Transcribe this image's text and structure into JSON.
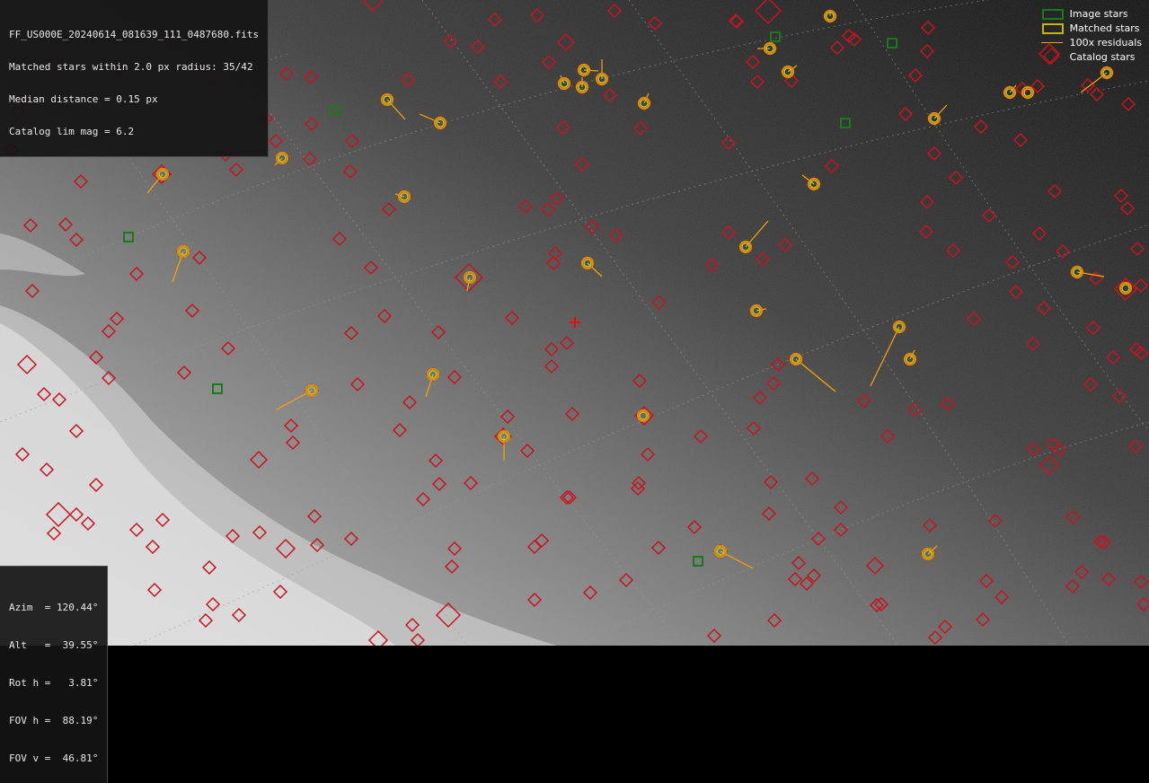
{
  "header": {
    "filename": "FF_US000E_20240614_081639_111_0487680.fits",
    "matched_line": "Matched stars within 2.0 px radius: 35/42",
    "median_line": "Median distance = 0.15 px",
    "catalog_line": "Catalog lim mag = 6.2"
  },
  "pointing": {
    "azim": "Azim  = 120.44°",
    "alt": "Alt   =  39.55°",
    "rot": "Rot h =   3.81°",
    "fov_h": "FOV h =  88.19°",
    "fov_v": "FOV v =  46.81°"
  },
  "legend": {
    "image_stars": "Image stars",
    "matched_stars": "Matched stars",
    "residuals": "100x residuals",
    "catalog_stars": "Catalog stars"
  },
  "colors": {
    "catalog": "#c8141e",
    "image": "#1a7a1a",
    "matched_outer": "#e08a00",
    "matched_inner": "#b4d22a",
    "residual": "#ffa500",
    "center_cross": "#ff0000"
  },
  "stars": {
    "image_unmatched": [
      [
        373,
        123
      ],
      [
        941,
        137
      ],
      [
        143,
        264
      ],
      [
        242,
        433
      ],
      [
        777,
        625
      ],
      [
        863,
        41
      ],
      [
        993,
        48
      ]
    ],
    "matched": [
      [
        431,
        111,
        451,
        133
      ],
      [
        490,
        137,
        467,
        127
      ],
      [
        314,
        176,
        306,
        184
      ],
      [
        181,
        194,
        164,
        215
      ],
      [
        204,
        280,
        192,
        314
      ],
      [
        450,
        219,
        440,
        216
      ],
      [
        523,
        309,
        520,
        324
      ],
      [
        654,
        293,
        670,
        308
      ],
      [
        628,
        93,
        624,
        84
      ],
      [
        648,
        97,
        648,
        86
      ],
      [
        650,
        78,
        666,
        79
      ],
      [
        670,
        88,
        670,
        66
      ],
      [
        717,
        115,
        722,
        104
      ],
      [
        857,
        54,
        843,
        54
      ],
      [
        877,
        80,
        887,
        73
      ],
      [
        924,
        18,
        924,
        13
      ],
      [
        906,
        205,
        893,
        195
      ],
      [
        830,
        275,
        855,
        246
      ],
      [
        842,
        346,
        853,
        344
      ],
      [
        1040,
        132,
        1054,
        117
      ],
      [
        1124,
        103,
        1131,
        95
      ],
      [
        1144,
        103,
        1144,
        103
      ],
      [
        1232,
        81,
        1203,
        103
      ],
      [
        1199,
        303,
        1229,
        308
      ],
      [
        1253,
        321,
        1253,
        321
      ],
      [
        1001,
        364,
        969,
        430
      ],
      [
        1013,
        400,
        1018,
        390
      ],
      [
        886,
        400,
        930,
        436
      ],
      [
        716,
        463,
        716,
        463
      ],
      [
        347,
        435,
        308,
        456
      ],
      [
        482,
        417,
        474,
        442
      ],
      [
        561,
        486,
        561,
        513
      ],
      [
        802,
        614,
        838,
        633
      ],
      [
        1033,
        617,
        1043,
        608
      ]
    ],
    "catalog_big": [
      [
        415,
        2,
        10
      ],
      [
        855,
        12,
        14
      ],
      [
        630,
        47,
        9
      ],
      [
        1168,
        60,
        11
      ],
      [
        522,
        309,
        15
      ],
      [
        30,
        406,
        10
      ],
      [
        65,
        573,
        13
      ],
      [
        499,
        685,
        13
      ],
      [
        1168,
        518,
        10
      ],
      [
        1253,
        322,
        12
      ],
      [
        421,
        713,
        10
      ],
      [
        318,
        611,
        10
      ],
      [
        288,
        512,
        9
      ],
      [
        974,
        630,
        9
      ],
      [
        717,
        463,
        10
      ],
      [
        180,
        194,
        10
      ],
      [
        560,
        486,
        9
      ]
    ],
    "catalog_small": [
      [
        551,
        22
      ],
      [
        598,
        17
      ],
      [
        684,
        12
      ],
      [
        729,
        26
      ],
      [
        820,
        24
      ],
      [
        838,
        69
      ],
      [
        843,
        91
      ],
      [
        932,
        53
      ],
      [
        945,
        40
      ],
      [
        1019,
        84
      ],
      [
        1032,
        57
      ],
      [
        1033,
        31
      ],
      [
        1040,
        171
      ],
      [
        1008,
        127
      ],
      [
        1064,
        198
      ],
      [
        1092,
        141
      ],
      [
        1101,
        240
      ],
      [
        1136,
        156
      ],
      [
        1174,
        213
      ],
      [
        1157,
        260
      ],
      [
        1183,
        280
      ],
      [
        1127,
        292
      ],
      [
        1131,
        325
      ],
      [
        1162,
        343
      ],
      [
        1217,
        365
      ],
      [
        1150,
        383
      ],
      [
        1239,
        398
      ],
      [
        1214,
        428
      ],
      [
        1246,
        441
      ],
      [
        1264,
        497
      ],
      [
        1225,
        603
      ],
      [
        1204,
        637
      ],
      [
        1234,
        645
      ],
      [
        1270,
        648
      ],
      [
        1273,
        673
      ],
      [
        1194,
        653
      ],
      [
        1115,
        665
      ],
      [
        1094,
        690
      ],
      [
        1052,
        698
      ],
      [
        1041,
        710
      ],
      [
        1098,
        647
      ],
      [
        1108,
        580
      ],
      [
        1194,
        576
      ],
      [
        1035,
        585
      ],
      [
        988,
        486
      ],
      [
        1055,
        450
      ],
      [
        1018,
        456
      ],
      [
        962,
        446
      ],
      [
        936,
        565
      ],
      [
        936,
        590
      ],
      [
        911,
        600
      ],
      [
        889,
        627
      ],
      [
        885,
        645
      ],
      [
        906,
        641
      ],
      [
        898,
        650
      ],
      [
        858,
        537
      ],
      [
        904,
        533
      ],
      [
        856,
        572
      ],
      [
        839,
        477
      ],
      [
        846,
        443
      ],
      [
        866,
        406
      ],
      [
        861,
        427
      ],
      [
        780,
        486
      ],
      [
        773,
        587
      ],
      [
        733,
        610
      ],
      [
        697,
        646
      ],
      [
        657,
        660
      ],
      [
        595,
        668
      ],
      [
        634,
        554
      ],
      [
        603,
        602
      ],
      [
        595,
        609
      ],
      [
        506,
        611
      ],
      [
        503,
        631
      ],
      [
        524,
        538
      ],
      [
        489,
        539
      ],
      [
        485,
        513
      ],
      [
        471,
        556
      ],
      [
        445,
        479
      ],
      [
        456,
        448
      ],
      [
        398,
        428
      ],
      [
        391,
        600
      ],
      [
        353,
        607
      ],
      [
        350,
        575
      ],
      [
        326,
        493
      ],
      [
        324,
        474
      ],
      [
        312,
        659
      ],
      [
        266,
        685
      ],
      [
        237,
        673
      ],
      [
        229,
        691
      ],
      [
        233,
        632
      ],
      [
        259,
        597
      ],
      [
        289,
        593
      ],
      [
        172,
        657
      ],
      [
        170,
        609
      ],
      [
        152,
        590
      ],
      [
        181,
        579
      ],
      [
        98,
        583
      ],
      [
        107,
        540
      ],
      [
        85,
        480
      ],
      [
        52,
        523
      ],
      [
        25,
        506
      ],
      [
        66,
        445
      ],
      [
        49,
        439
      ],
      [
        121,
        421
      ],
      [
        107,
        398
      ],
      [
        205,
        415
      ],
      [
        254,
        388
      ],
      [
        130,
        355
      ],
      [
        121,
        369
      ],
      [
        36,
        324
      ],
      [
        152,
        305
      ],
      [
        214,
        346
      ],
      [
        222,
        287
      ],
      [
        85,
        267
      ],
      [
        73,
        250
      ],
      [
        34,
        251
      ],
      [
        90,
        202
      ],
      [
        13,
        167
      ],
      [
        20,
        125
      ],
      [
        25,
        112
      ],
      [
        58,
        74
      ],
      [
        131,
        78
      ],
      [
        192,
        48
      ],
      [
        242,
        91
      ],
      [
        225,
        79
      ],
      [
        319,
        82
      ],
      [
        346,
        86
      ],
      [
        296,
        132
      ],
      [
        347,
        138
      ],
      [
        345,
        177
      ],
      [
        263,
        189
      ],
      [
        251,
        172
      ],
      [
        307,
        157
      ],
      [
        392,
        157
      ],
      [
        390,
        191
      ],
      [
        378,
        266
      ],
      [
        413,
        298
      ],
      [
        433,
        233
      ],
      [
        391,
        371
      ],
      [
        428,
        352
      ],
      [
        488,
        370
      ],
      [
        506,
        420
      ],
      [
        570,
        354
      ],
      [
        614,
        389
      ],
      [
        614,
        408
      ],
      [
        631,
        382
      ],
      [
        637,
        461
      ],
      [
        565,
        464
      ],
      [
        587,
        502
      ],
      [
        631,
        554
      ],
      [
        618,
        282
      ],
      [
        616,
        293
      ],
      [
        610,
        233
      ],
      [
        620,
        221
      ],
      [
        585,
        230
      ],
      [
        659,
        253
      ],
      [
        686,
        262
      ],
      [
        734,
        337
      ],
      [
        793,
        295
      ],
      [
        811,
        259
      ],
      [
        849,
        289
      ],
      [
        874,
        273
      ],
      [
        811,
        159
      ],
      [
        713,
        143
      ],
      [
        627,
        142
      ],
      [
        648,
        183
      ],
      [
        679,
        106
      ],
      [
        557,
        91
      ],
      [
        501,
        46
      ],
      [
        532,
        52
      ],
      [
        454,
        89
      ],
      [
        611,
        69
      ],
      [
        712,
        424
      ],
      [
        721,
        506
      ],
      [
        711,
        538
      ],
      [
        710,
        544
      ],
      [
        795,
        708
      ],
      [
        862,
        691
      ],
      [
        976,
        674
      ],
      [
        981,
        673
      ],
      [
        1265,
        389
      ],
      [
        1270,
        393
      ],
      [
        1256,
        116
      ],
      [
        1248,
        218
      ],
      [
        1255,
        232
      ],
      [
        1266,
        277
      ],
      [
        1229,
        604
      ],
      [
        1172,
        495
      ],
      [
        1179,
        501
      ],
      [
        1150,
        500
      ],
      [
        1084,
        355
      ],
      [
        1061,
        279
      ],
      [
        1031,
        258
      ],
      [
        1032,
        225
      ],
      [
        1155,
        96
      ],
      [
        1221,
        105
      ],
      [
        1211,
        95
      ],
      [
        1138,
        99
      ],
      [
        926,
        185
      ],
      [
        881,
        90
      ],
      [
        1270,
        318
      ],
      [
        1220,
        310
      ],
      [
        951,
        44
      ],
      [
        819,
        23
      ],
      [
        465,
        713
      ],
      [
        459,
        696
      ],
      [
        85,
        573
      ],
      [
        60,
        594
      ]
    ],
    "center_cross": [
      640,
      359
    ]
  }
}
